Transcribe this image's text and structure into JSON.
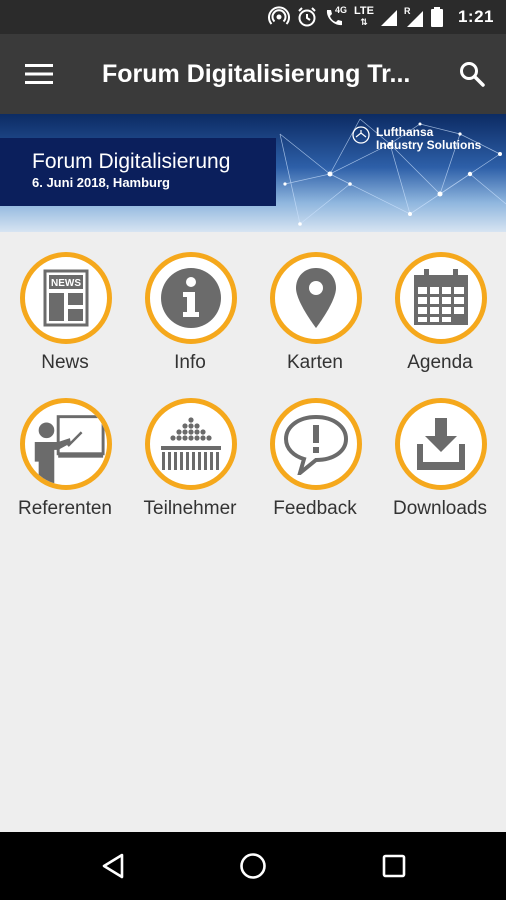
{
  "status_bar": {
    "network": "4G",
    "lte": "LTE",
    "roaming": "R",
    "time": "1:21"
  },
  "toolbar": {
    "title": "Forum Digitalisierung Tr..."
  },
  "banner": {
    "title": "Forum Digitalisierung",
    "subtitle": "6. Juni 2018, Hamburg",
    "brand_line1": "Lufthansa",
    "brand_line2": "Industry Solutions"
  },
  "tiles": [
    {
      "label": "News",
      "icon": "newspaper-icon"
    },
    {
      "label": "Info",
      "icon": "info-icon"
    },
    {
      "label": "Karten",
      "icon": "map-pin-icon"
    },
    {
      "label": "Agenda",
      "icon": "calendar-icon"
    },
    {
      "label": "Referenten",
      "icon": "presenter-icon"
    },
    {
      "label": "Teilnehmer",
      "icon": "audience-icon"
    },
    {
      "label": "Feedback",
      "icon": "speech-bubble-icon"
    },
    {
      "label": "Downloads",
      "icon": "download-icon"
    }
  ],
  "colors": {
    "accent": "#f5a81c",
    "icon_gray": "#6b6b6b",
    "toolbar": "#3a3a3a",
    "banner_box": "#0b1f5c"
  },
  "news_icon_text": "NEWS"
}
